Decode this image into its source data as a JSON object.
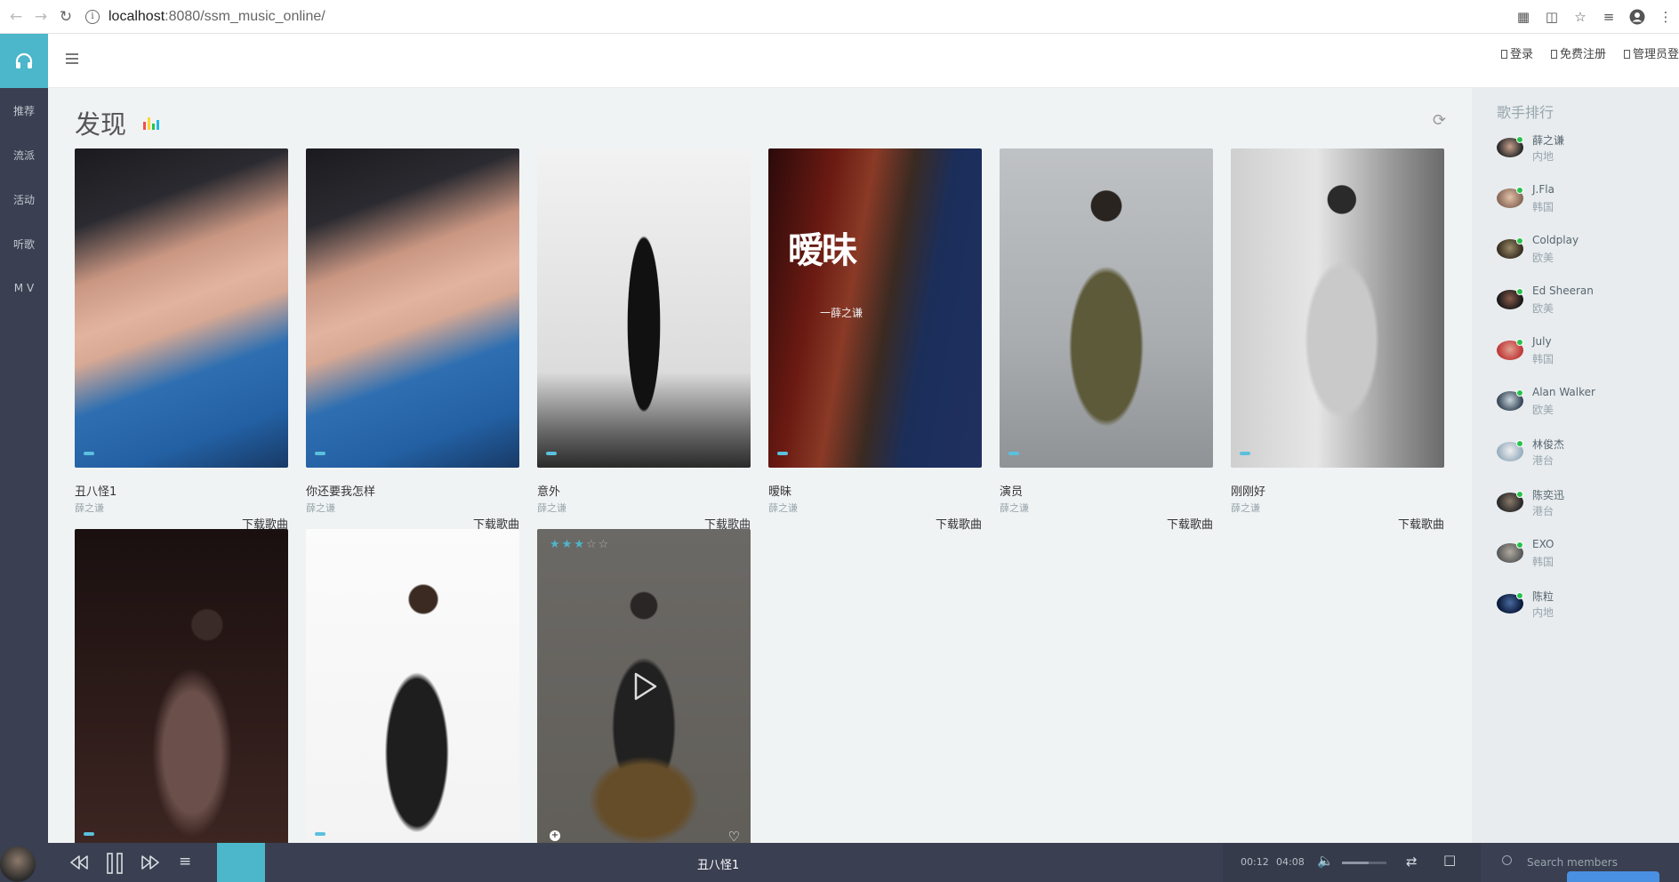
{
  "browser": {
    "url_host": "localhost",
    "url_path": ":8080/ssm_music_online/"
  },
  "sidebar": {
    "items": [
      {
        "label": "推荐"
      },
      {
        "label": "流派"
      },
      {
        "label": "活动"
      },
      {
        "label": "听歌"
      },
      {
        "label": "M V"
      }
    ]
  },
  "header": {
    "links": [
      {
        "label": "登录"
      },
      {
        "label": "免费注册"
      },
      {
        "label": "管理员登"
      }
    ]
  },
  "main": {
    "title": "发现",
    "download_label": "下载歌曲",
    "songs": [
      {
        "title": "丑八怪1",
        "artist": "薛之谦"
      },
      {
        "title": "你还要我怎样",
        "artist": "薛之谦"
      },
      {
        "title": "意外",
        "artist": "薛之谦"
      },
      {
        "title": "暧昧",
        "artist": "薛之谦"
      },
      {
        "title": "演员",
        "artist": "薛之谦"
      },
      {
        "title": "刚刚好",
        "artist": "薛之谦"
      }
    ],
    "poster_text": "暧昧",
    "poster_subtext": "一薛之谦",
    "hover_rating": 3,
    "hover_rating_max": 5
  },
  "aside": {
    "title": "歌手排行",
    "singers": [
      {
        "name": "薛之谦",
        "region": "内地"
      },
      {
        "name": "J.Fla",
        "region": "韩国"
      },
      {
        "name": "Coldplay",
        "region": "欧美"
      },
      {
        "name": "Ed Sheeran",
        "region": "欧美"
      },
      {
        "name": "July",
        "region": "韩国"
      },
      {
        "name": "Alan Walker",
        "region": "欧美"
      },
      {
        "name": "林俊杰",
        "region": "港台"
      },
      {
        "name": "陈奕迅",
        "region": "港台"
      },
      {
        "name": "EXO",
        "region": "韩国"
      },
      {
        "name": "陈粒",
        "region": "内地"
      }
    ]
  },
  "player": {
    "now_playing": "丑八怪1",
    "current_time": "00:12",
    "total_time": "04:08",
    "search_placeholder": "Search members"
  },
  "colors": {
    "accent": "#4cb6cb",
    "sidebar_bg": "#3a3f51",
    "online_dot": "#27c24c"
  }
}
